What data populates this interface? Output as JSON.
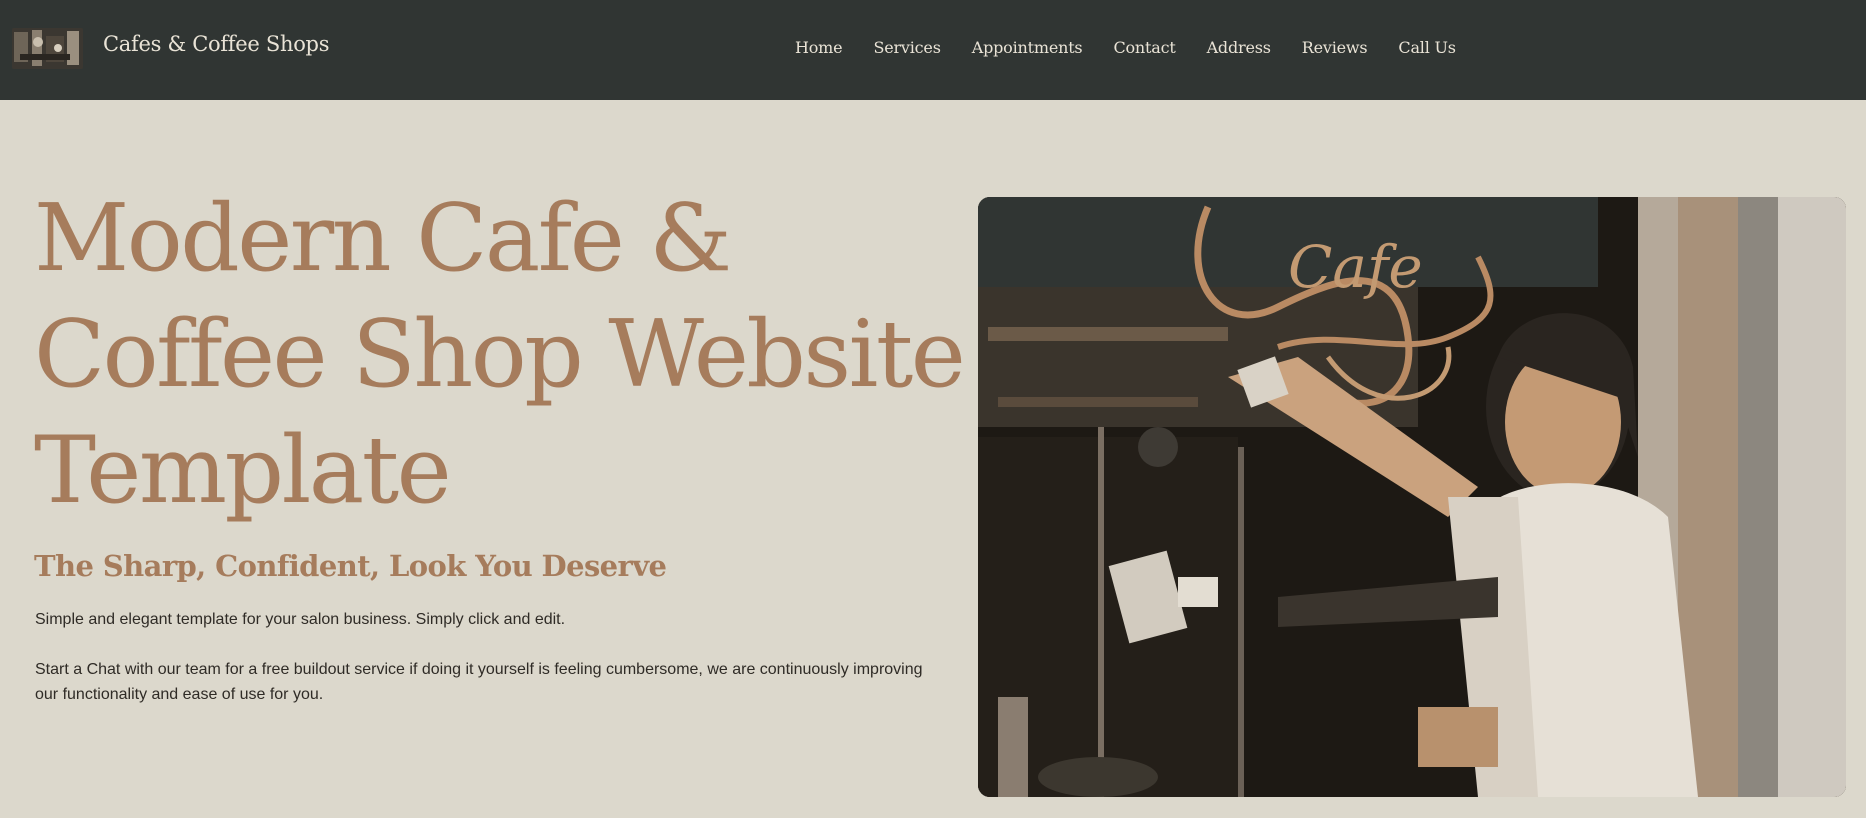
{
  "header": {
    "brand": "Cafes & Coffee Shops",
    "logo_icon": "cafe-thumbnail-logo",
    "nav": [
      "Home",
      "Services",
      "Appointments",
      "Contact",
      "Address",
      "Reviews",
      "Call Us"
    ]
  },
  "hero": {
    "title_lines": [
      "Modern Cafe &",
      "Coffee Shop Website",
      "Template"
    ],
    "subtitle": "The Sharp, Confident, Look You Deserve",
    "paragraph1": "Simple and elegant template for your salon business. Simply click and edit.",
    "paragraph2": "Start a Chat with our team for a free buildout service if doing it yourself is feeling cumbersome, we are continuously improving our functionality and ease of use for you.",
    "image_icon": "barista-writing-cafe-sign-photo",
    "image_sign_text": "Cafe"
  },
  "colors": {
    "header_bg": "#303533",
    "page_bg": "#dcd8cc",
    "accent": "#a67c5c",
    "nav_text": "#e9e3d6",
    "body_text": "#2f2b26"
  }
}
